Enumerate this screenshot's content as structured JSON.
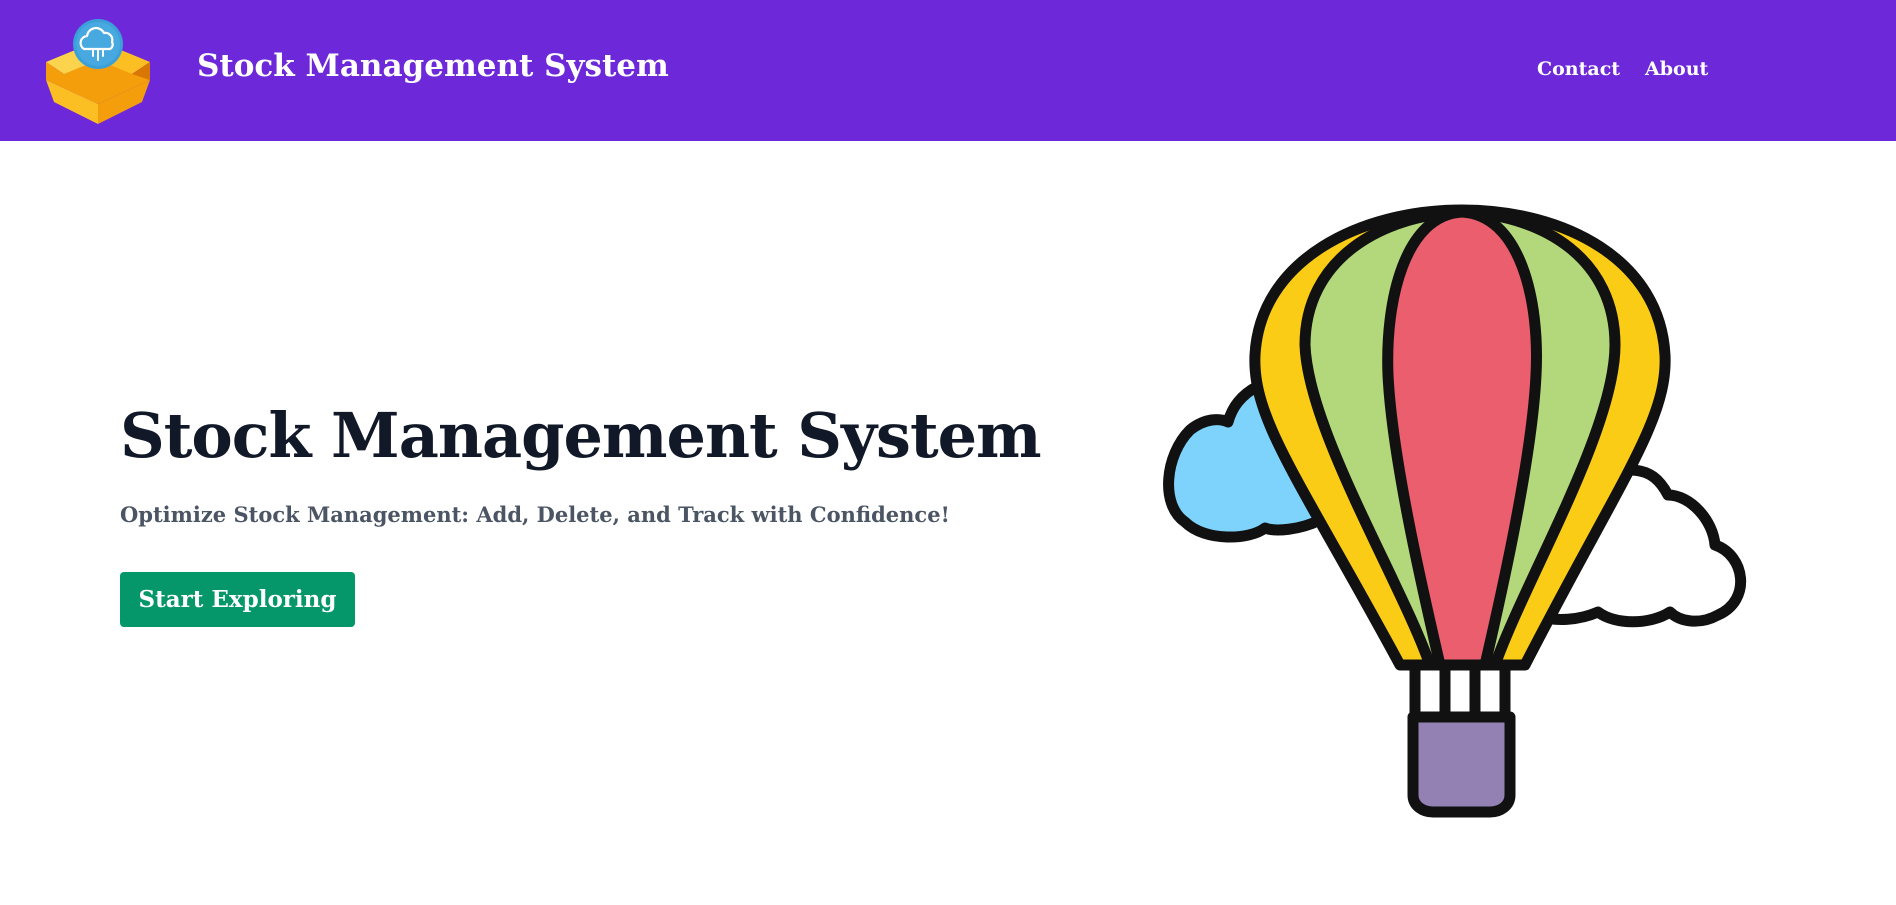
{
  "header": {
    "brand_title": "Stock Management System",
    "nav": {
      "contact": "Contact",
      "about": "About"
    }
  },
  "hero": {
    "title": "Stock Management System",
    "subtitle": "Optimize Stock Management: Add, Delete, and Track with Confidence!",
    "cta_label": "Start Exploring"
  },
  "icons": {
    "logo": "box-cloud-logo-icon",
    "illustration": "hot-air-balloon-illustration"
  },
  "colors": {
    "nav_background": "#6d28d9",
    "button_background": "#059669",
    "title_text": "#111827",
    "subtitle_text": "#4b5563"
  }
}
